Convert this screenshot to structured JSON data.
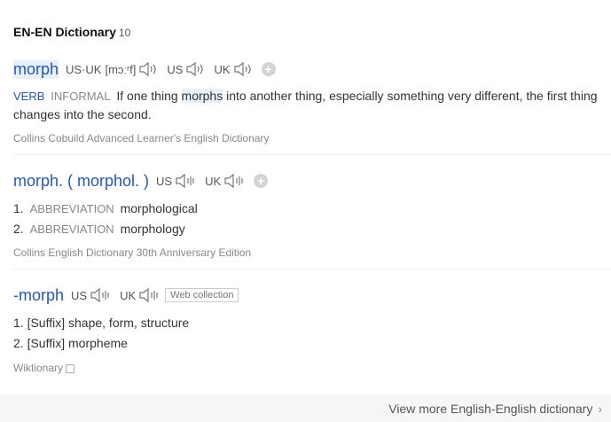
{
  "header": {
    "title": "EN-EN Dictionary",
    "count": "10"
  },
  "entries": [
    {
      "word": "morph",
      "us_uk_label": "US·UK",
      "phonetic": "[mɔːʳf]",
      "us_label": "US",
      "uk_label": "UK",
      "pos": "VERB",
      "register": "INFORMAL",
      "def_before": "If one thing ",
      "def_highlight": "morphs",
      "def_after": " into another thing, especially something very different, the first thing changes into the second.",
      "source": "Collins Cobuild Advanced Learner's English Dictionary"
    },
    {
      "word": "morph. ( morphol. )",
      "us_label": "US",
      "uk_label": "UK",
      "items": [
        {
          "num": "1.",
          "pos": "ABBREVIATION",
          "text": "morphological"
        },
        {
          "num": "2.",
          "pos": "ABBREVIATION",
          "text": "morphology"
        }
      ],
      "source": "Collins English Dictionary 30th Anniversary Edition"
    },
    {
      "word": "-morph",
      "us_label": "US",
      "uk_label": "UK",
      "tag": "Web collection",
      "items": [
        {
          "num": "1.",
          "text": "[Suffix] shape, form, structure"
        },
        {
          "num": "2.",
          "text": "[Suffix] morpheme"
        }
      ],
      "source": "Wiktionary"
    }
  ],
  "footer": {
    "more_label": "View more English-English dictionary",
    "chevron": "›"
  },
  "icons": {
    "speaker": "speaker-icon",
    "plus": "plus-icon",
    "external": "external-link-icon",
    "chevron": "chevron-right-icon"
  },
  "colors": {
    "link": "#2458b6",
    "highlight": "#e7f0fa",
    "muted": "#888888"
  }
}
